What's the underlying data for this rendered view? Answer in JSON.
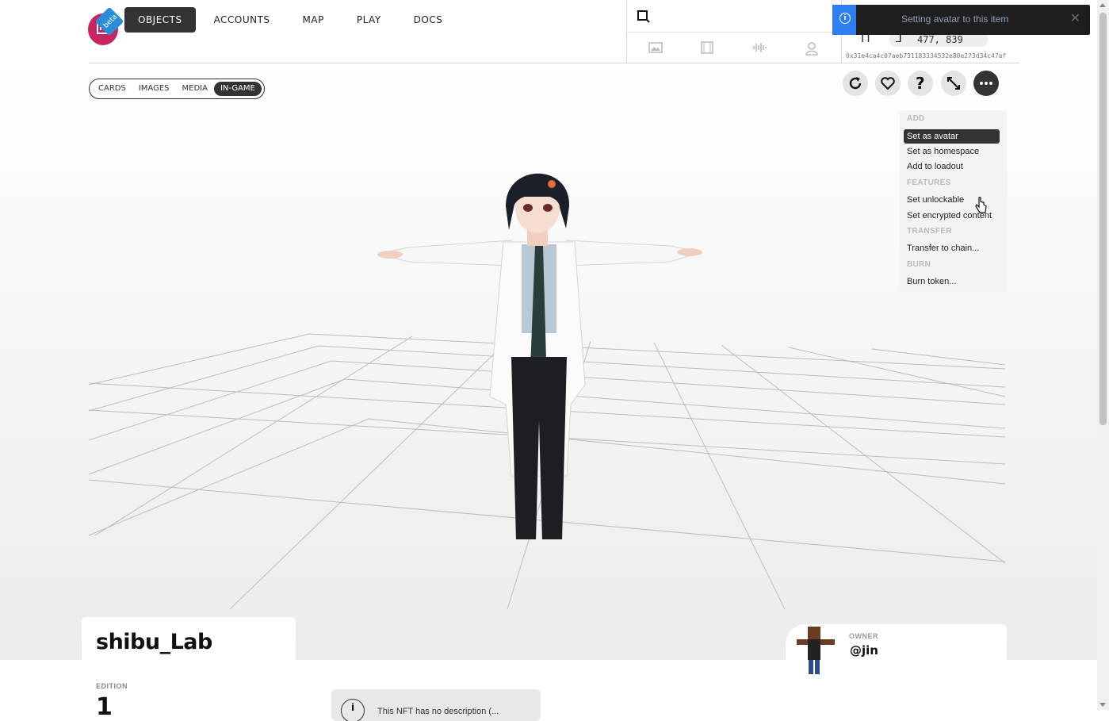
{
  "header": {
    "logo_badge": "beta",
    "nav": [
      {
        "label": "OBJECTS",
        "active": true
      },
      {
        "label": "ACCOUNTS",
        "active": false
      },
      {
        "label": "MAP",
        "active": false
      },
      {
        "label": "PLAY",
        "active": false
      },
      {
        "label": "DOCS",
        "active": false
      }
    ],
    "media_filters": [
      "image-icon",
      "film-icon",
      "audio-icon",
      "avatar-icon"
    ],
    "coords": "477, 839",
    "address": "0x31e4ca4c07aeb731183334532e80e273d34c47af"
  },
  "toast": {
    "message": "Setting avatar to this item",
    "close": "✕"
  },
  "viewer": {
    "tabs": [
      {
        "label": "CARDS",
        "active": false
      },
      {
        "label": "IMAGES",
        "active": false
      },
      {
        "label": "MEDIA",
        "active": false
      },
      {
        "label": "IN-GAME",
        "active": true
      }
    ],
    "actions": [
      "reload-icon",
      "heart-icon",
      "help-icon",
      "expand-icon",
      "more-icon"
    ]
  },
  "menu": {
    "sections": {
      "add": "ADD",
      "features": "FEATURES",
      "transfer": "TRANSFER",
      "burn": "BURN"
    },
    "items": {
      "set_avatar": "Set as avatar",
      "set_homespace": "Set as homespace",
      "add_loadout": "Add to loadout",
      "set_unlockable": "Set unlockable",
      "set_encrypted": "Set encrypted content",
      "transfer_chain": "Transfer to chain...",
      "burn_token": "Burn token..."
    },
    "selected": "set_avatar"
  },
  "item": {
    "name": "shibu_Lab",
    "edition_label": "EDITION",
    "edition_value": "1",
    "info_text": "This NFT has no description (..."
  },
  "owner": {
    "label": "OWNER",
    "name": "@jin"
  },
  "colors": {
    "accent": "#333333",
    "logo": "#c8245e",
    "beta": "#2a8dd8",
    "toast_icon": "#2d7ff0"
  }
}
